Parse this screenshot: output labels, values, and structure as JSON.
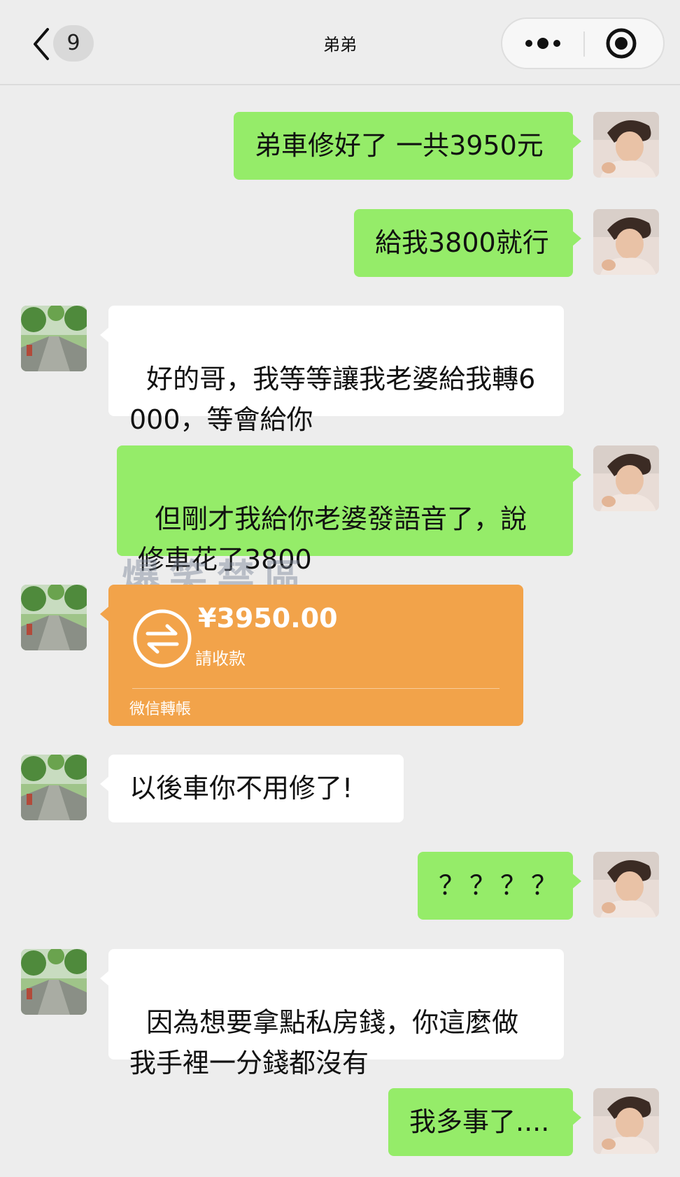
{
  "header": {
    "back_count": "9",
    "title": "弟弟"
  },
  "messages": {
    "m1": "弟車修好了 一共3950元",
    "m2": "給我3800就行",
    "m3": "好的哥，我等等讓我老婆給我轉6\n000，等會給你",
    "m4": "但剛才我給你老婆發語音了，說\n修車花了3800",
    "m6": "以後車你不用修了!",
    "m7": "？？？？",
    "m8": "因為想要拿點私房錢，你這麼做\n我手裡一分錢都沒有",
    "m9": "我多事了...."
  },
  "transfer": {
    "amount": "¥3950.00",
    "status": "請收款",
    "footer": "微信轉帳"
  },
  "watermark": "爆笑禁區",
  "colors": {
    "self_bubble": "#95ec69",
    "other_bubble": "#ffffff",
    "transfer": "#f2a34a",
    "background": "#ededed"
  }
}
